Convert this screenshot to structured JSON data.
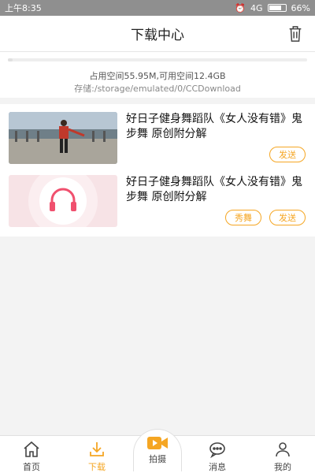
{
  "status_bar": {
    "time": "上午8:35",
    "network": "4G",
    "battery": "66%"
  },
  "header": {
    "title": "下载中心",
    "trash_icon": "trash-icon"
  },
  "storage": {
    "usage_text": "占用空间55.95M,可用空间12.4GB",
    "path_text": "存储:/storage/emulated/0/CCDownload"
  },
  "downloads": [
    {
      "title": "好日子健身舞蹈队《女人没有错》鬼步舞 原创附分解",
      "thumbnail": "dance-video-thumbnail",
      "buttons": [
        "发送"
      ]
    },
    {
      "title": "好日子健身舞蹈队《女人没有错》鬼步舞 原创附分解",
      "thumbnail": "headphones-audio-thumbnail",
      "buttons": [
        "秀舞",
        "发送"
      ]
    }
  ],
  "tabbar": {
    "home": "首页",
    "download": "下载",
    "shoot": "拍摄",
    "messages": "消息",
    "mine": "我的"
  },
  "colors": {
    "accent": "#f5a623",
    "statusbar": "#8f8f8f",
    "background": "#f3f3f3"
  }
}
